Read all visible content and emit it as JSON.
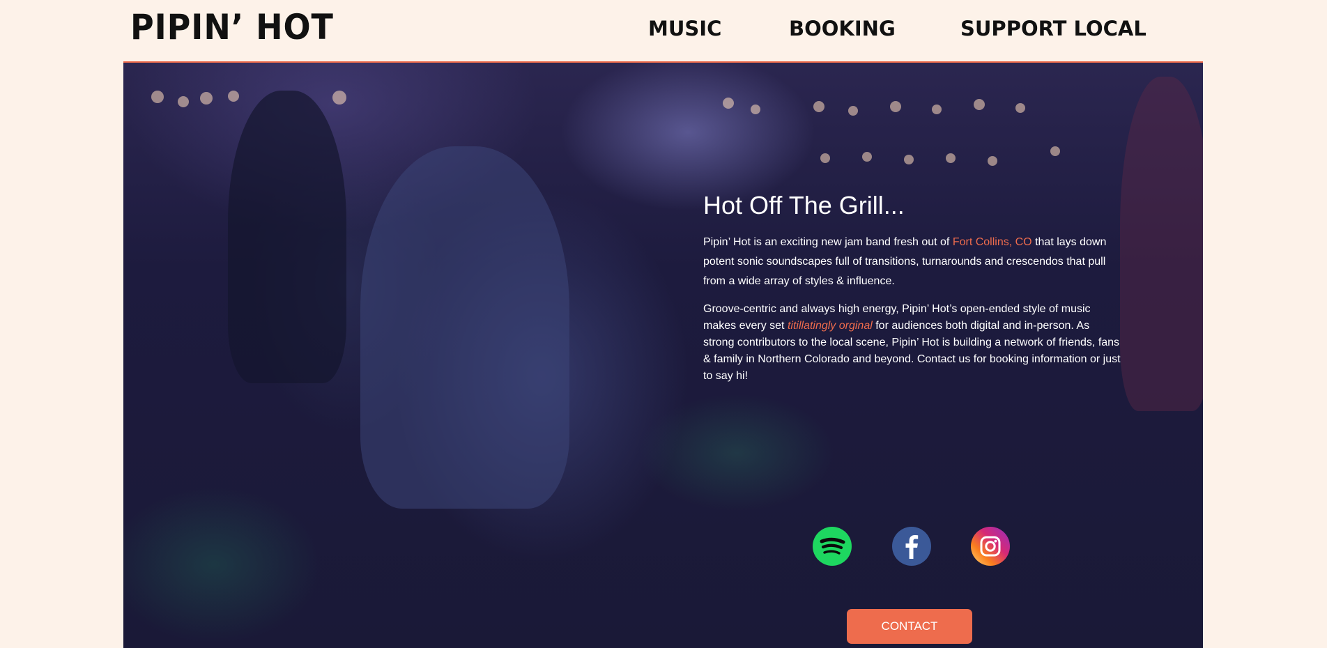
{
  "brand": {
    "logo": "PIPIN’ HOT"
  },
  "nav": {
    "music": "MUSIC",
    "booking": "BOOKING",
    "support": "SUPPORT LOCAL"
  },
  "hero": {
    "title": "Hot Off The Grill...",
    "para1": {
      "before": "Pipin’ Hot is an exciting new jam band fresh out of ",
      "link": "Fort Collins, CO",
      "after": " that lays down potent sonic soundscapes full of transitions, turnarounds and crescendos that pull from a wide array of styles & influence."
    },
    "para2": {
      "before": "Groove-centric and always high energy, Pipin’ Hot’s open-ended style of music makes every set ",
      "emphasis": "titillatingly orginal",
      "after": " for audiences both digital and in-person. As strong contributors to the local scene, Pipin’ Hot is building a network of friends, fans & family in Northern Colorado and beyond. Contact us for booking information or just to say hi!"
    },
    "socials": [
      {
        "name": "spotify",
        "icon": "spotify-icon",
        "color": "#1ed760"
      },
      {
        "name": "facebook",
        "icon": "facebook-icon",
        "color": "#3b5998"
      },
      {
        "name": "instagram",
        "icon": "instagram-icon",
        "color": "#d62976"
      }
    ],
    "contact_label": "CONTACT"
  },
  "colors": {
    "page_bg": "#fdf2e9",
    "accent": "#ee6c4d",
    "hero_overlay": "#1d1b3e",
    "text": "#111111"
  }
}
